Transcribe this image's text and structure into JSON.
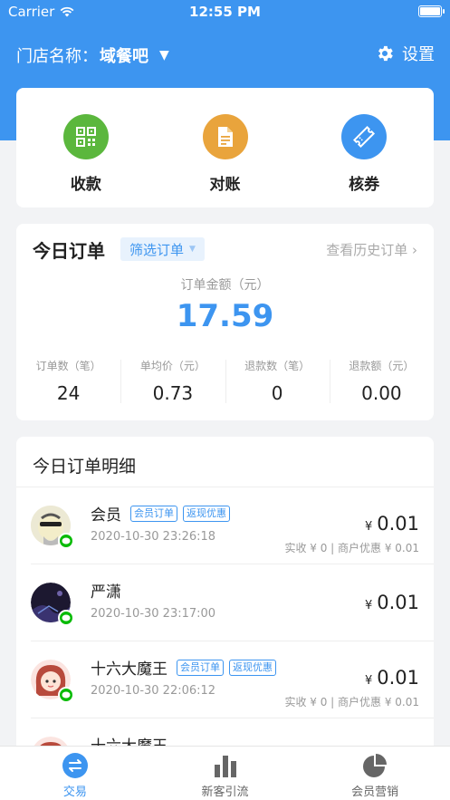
{
  "status_bar": {
    "carrier": "Carrier",
    "time": "12:55 PM"
  },
  "header": {
    "store_label": "门店名称：",
    "store_name": "域餐吧",
    "settings_label": "设置"
  },
  "actions": [
    {
      "label": "收款",
      "icon": "qr-code-icon",
      "color": "#5bb73d"
    },
    {
      "label": "对账",
      "icon": "document-icon",
      "color": "#e9a43c"
    },
    {
      "label": "核券",
      "icon": "ticket-icon",
      "color": "#3d95f0"
    }
  ],
  "today": {
    "title": "今日订单",
    "filter_label": "筛选订单",
    "history_link": "查看历史订单 ›",
    "amount_label": "订单金额（元）",
    "amount": "17.59",
    "stats": [
      {
        "label": "订单数（笔）",
        "value": "24"
      },
      {
        "label": "单均价（元）",
        "value": "0.73"
      },
      {
        "label": "退款数（笔）",
        "value": "0"
      },
      {
        "label": "退款额（元）",
        "value": "0.00"
      }
    ]
  },
  "details": {
    "title": "今日订单明细",
    "currency": "¥",
    "orders": [
      {
        "name": "会员",
        "tags": [
          "会员订单",
          "返现优惠"
        ],
        "time": "2020-10-30 23:26:18",
        "amount": "0.01",
        "sub": "实收 ¥ 0 | 商户优惠 ¥ 0.01"
      },
      {
        "name": "严潇",
        "tags": [],
        "time": "2020-10-30 23:17:00",
        "amount": "0.01",
        "sub": ""
      },
      {
        "name": "十六大魔王",
        "tags": [
          "会员订单",
          "返现优惠"
        ],
        "time": "2020-10-30 22:06:12",
        "amount": "0.01",
        "sub": "实收 ¥ 0 | 商户优惠 ¥ 0.01"
      },
      {
        "name": "十六大魔王",
        "tags": [],
        "time": "",
        "amount": "",
        "sub": ""
      }
    ]
  },
  "tabbar": [
    {
      "label": "交易",
      "icon": "exchange-icon",
      "active": true
    },
    {
      "label": "新客引流",
      "icon": "bar-chart-icon",
      "active": false
    },
    {
      "label": "会员营销",
      "icon": "pie-chart-icon",
      "active": false
    }
  ],
  "colors": {
    "primary": "#3d95f0",
    "wechat": "#09bb07"
  }
}
